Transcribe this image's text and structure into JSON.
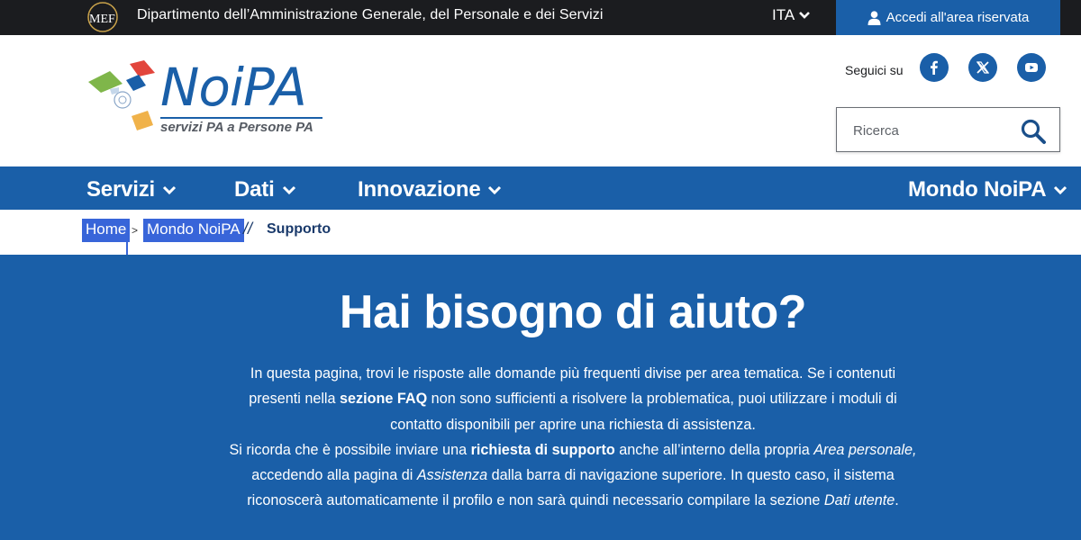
{
  "topbar": {
    "logo_text": "MEF",
    "department": "Dipartimento dell’Amministrazione Generale, del Personale e dei Servizi",
    "language": "ITA",
    "login_label": "Accedi all'area riservata"
  },
  "header": {
    "logo": {
      "name": "NoiPA",
      "tagline": "servizi PA a Persone PA"
    },
    "follow_label": "Seguici su",
    "social": [
      "facebook-icon",
      "x-icon",
      "youtube-icon"
    ],
    "search_placeholder": "Ricerca"
  },
  "nav": {
    "items": [
      "Servizi",
      "Dati",
      "Innovazione",
      "Mondo NoiPA"
    ]
  },
  "breadcrumb": {
    "home": "Home",
    "separator": ">",
    "parent": "Mondo NoiPA",
    "divider": "//",
    "current": "Supporto"
  },
  "hero": {
    "title": "Hai bisogno di aiuto?",
    "p1_a": "In questa pagina, trovi le risposte alle domande più frequenti divise per area tematica. Se i contenuti presenti nella ",
    "p1_b": "sezione FAQ",
    "p1_c": " non sono sufficienti a risolvere la problematica, puoi utilizzare i moduli di contatto disponibili per aprire una richiesta di assistenza.",
    "p2_a": "Si ricorda che è possibile inviare una ",
    "p2_b": "richiesta di supporto",
    "p2_c": " anche all’interno della propria ",
    "p2_d": "Area personale,",
    "p2_e": " accedendo alla pagina di ",
    "p2_f": "Assistenza",
    "p2_g": " dalla barra di navigazione superiore. In questo caso, il sistema riconoscerà automaticamente il profilo e non sarà quindi necessario compilare la sezione ",
    "p2_h": "Dati utente",
    "p2_i": "."
  },
  "colors": {
    "brand_blue": "#1a5fa8",
    "topbar_bg": "#1b1c1f",
    "breadcrumb_highlight": "#3865d9"
  }
}
